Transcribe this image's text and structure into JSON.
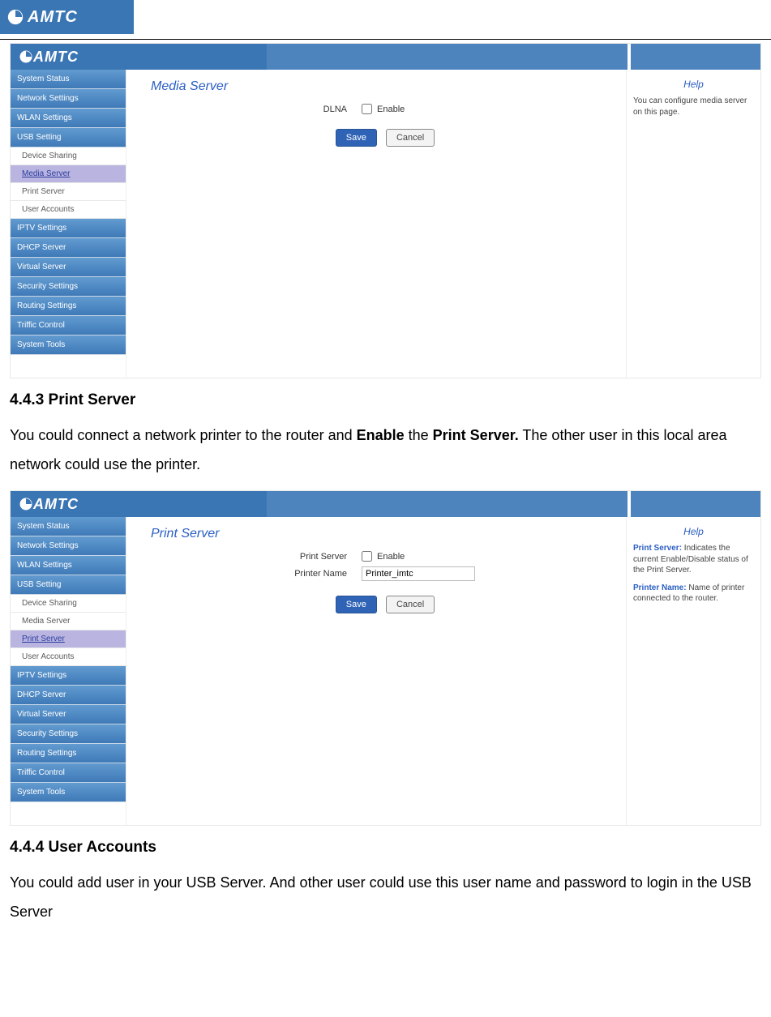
{
  "brand": "AMTC",
  "screenshot1": {
    "sidebar_main": [
      "System Status",
      "Network Settings",
      "WLAN Settings",
      "USB Setting"
    ],
    "sidebar_sub": [
      "Device Sharing",
      "Media Server",
      "Print Server",
      "User Accounts"
    ],
    "active_sub": "Media Server",
    "sidebar_rest": [
      "IPTV Settings",
      "DHCP Server",
      "Virtual Server",
      "Security Settings",
      "Routing Settings",
      "Triffic Control",
      "System Tools"
    ],
    "panel_title": "Media Server",
    "rows": [
      {
        "label": "DLNA",
        "type": "checkbox",
        "text": "Enable"
      }
    ],
    "buttons": {
      "save": "Save",
      "cancel": "Cancel"
    },
    "help_title": "Help",
    "help_body": "You can configure media server on this page."
  },
  "section1": {
    "heading": "4.4.3 Print Server",
    "para_parts": [
      "You could connect a network printer to the router and ",
      "Enable",
      " the ",
      "Print Server.",
      " The other user in this local area network could use the printer."
    ]
  },
  "screenshot2": {
    "sidebar_main": [
      "System Status",
      "Network Settings",
      "WLAN Settings",
      "USB Setting"
    ],
    "sidebar_sub": [
      "Device Sharing",
      "Media Server",
      "Print Server",
      "User Accounts"
    ],
    "active_sub": "Print Server",
    "sidebar_rest": [
      "IPTV Settings",
      "DHCP Server",
      "Virtual Server",
      "Security Settings",
      "Routing Settings",
      "Triffic Control",
      "System Tools"
    ],
    "panel_title": "Print Server",
    "rows": [
      {
        "label": "Print Server",
        "type": "checkbox",
        "text": "Enable"
      },
      {
        "label": "Printer Name",
        "type": "text",
        "value": "Printer_imtc"
      }
    ],
    "buttons": {
      "save": "Save",
      "cancel": "Cancel"
    },
    "help_title": "Help",
    "help_items": [
      {
        "b": "Print Server:",
        "t": " Indicates the current Enable/Disable status of the Print Server."
      },
      {
        "b": "Printer Name:",
        "t": " Name of printer connected to the router."
      }
    ]
  },
  "section2": {
    "heading": "4.4.4 User Accounts",
    "para": "You could add user in your USB Server. And other user could use this user name and password to login in the USB Server"
  }
}
